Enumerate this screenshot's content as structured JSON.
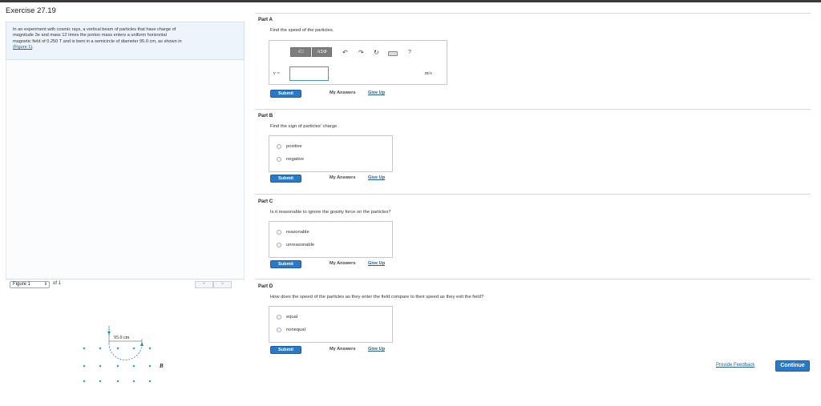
{
  "exercise": {
    "title": "Exercise 27.19",
    "problem_lines": [
      "In an experiment with cosmic rays, a vertical beam of particles that have charge of",
      "magnitude 3e and mass 12 times the proton mass enters a uniform horizontal",
      "magnetic field of 0.250 T and is bent in a semicircle of diameter 95.0 cm, as shown in"
    ],
    "figure_link": "(Figure 1)",
    "figure_link_suffix": "."
  },
  "figure_nav": {
    "select_value": "Figure 1",
    "of_text": "of 1",
    "prev": "<",
    "next": ">"
  },
  "figure": {
    "diameter_label": "95.0 cm",
    "field_label": "B"
  },
  "parts": {
    "a": {
      "title": "Part A",
      "question": "Find the speed of the particles.",
      "toolbar": {
        "btn1": "√□",
        "btn2": "ΑΣΦ",
        "help": "?"
      },
      "var_label": "v =",
      "input_value": "",
      "unit": "m/s",
      "submit": "Submit",
      "my_answers": "My Answers",
      "give_up": "Give Up"
    },
    "b": {
      "title": "Part B",
      "question": "Find the sign of particles' charge.",
      "options": [
        "positive",
        "negative"
      ],
      "submit": "Submit",
      "my_answers": "My Answers",
      "give_up": "Give Up"
    },
    "c": {
      "title": "Part C",
      "question": "Is it reasonable to ignore the gravity force on the particles?",
      "options": [
        "reasonable",
        "unreasonable"
      ],
      "submit": "Submit",
      "my_answers": "My Answers",
      "give_up": "Give Up"
    },
    "d": {
      "title": "Part D",
      "question": "How does the speed of the particles as they enter the field compare to their speed as they exit the field?",
      "options": [
        "equal",
        "nonequal"
      ],
      "submit": "Submit",
      "my_answers": "My Answers",
      "give_up": "Give Up"
    }
  },
  "footer": {
    "feedback": "Provide Feedback",
    "continue": "Continue"
  },
  "colors": {
    "accent": "#2a79c7",
    "link": "#1f5fa8",
    "problem_bg": "#eef4fb",
    "figure_dots": "#2aa8c9"
  }
}
